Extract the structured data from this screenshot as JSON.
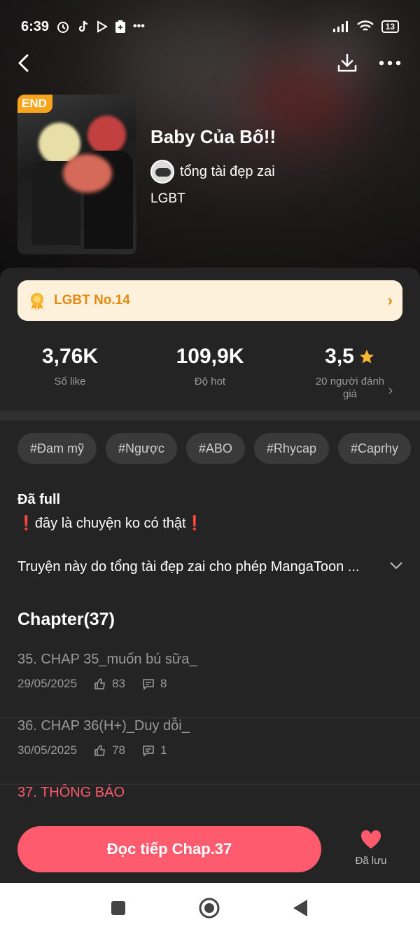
{
  "status_bar": {
    "time": "6:39",
    "battery": "13"
  },
  "book": {
    "end_badge": "END",
    "title": "Baby Của Bố!!",
    "author": "tổng tài đẹp zai",
    "genre": "LGBT"
  },
  "rank": {
    "label": "LGBT No.14"
  },
  "stats": [
    {
      "value": "3,76K",
      "label": "Số like"
    },
    {
      "value": "109,9K",
      "label": "Độ hot"
    },
    {
      "value": "3,5",
      "label": "20 người đánh giá"
    }
  ],
  "tags": [
    "#Đam mỹ",
    "#Ngược",
    "#ABO",
    "#Rhycap",
    "#Caprhy"
  ],
  "description": {
    "line1": "Đã full",
    "line2": "❗đây là chuyện ko có thật❗",
    "line3": "Truyện này do tổng tài đẹp zai  cho phép MangaToon ..."
  },
  "chapters": {
    "heading": "Chapter(37)",
    "items": [
      {
        "title": "35. CHAP 35_muốn bú sữa_",
        "date": "29/05/2025",
        "likes": "83",
        "comments": "8"
      },
      {
        "title": "36. CHAP 36(H+)_Duy dỗi_",
        "date": "30/05/2025",
        "likes": "78",
        "comments": "1"
      },
      {
        "title": "37. THÔNG BÁO"
      }
    ]
  },
  "actions": {
    "read_label": "Đọc tiếp Chap.37",
    "save_label": "Đã lưu"
  },
  "colors": {
    "accent": "#ff5b6e",
    "rank_bg": "#fdf1dc",
    "rank_text": "#e48a10",
    "end_badge": "#f7a51c"
  }
}
